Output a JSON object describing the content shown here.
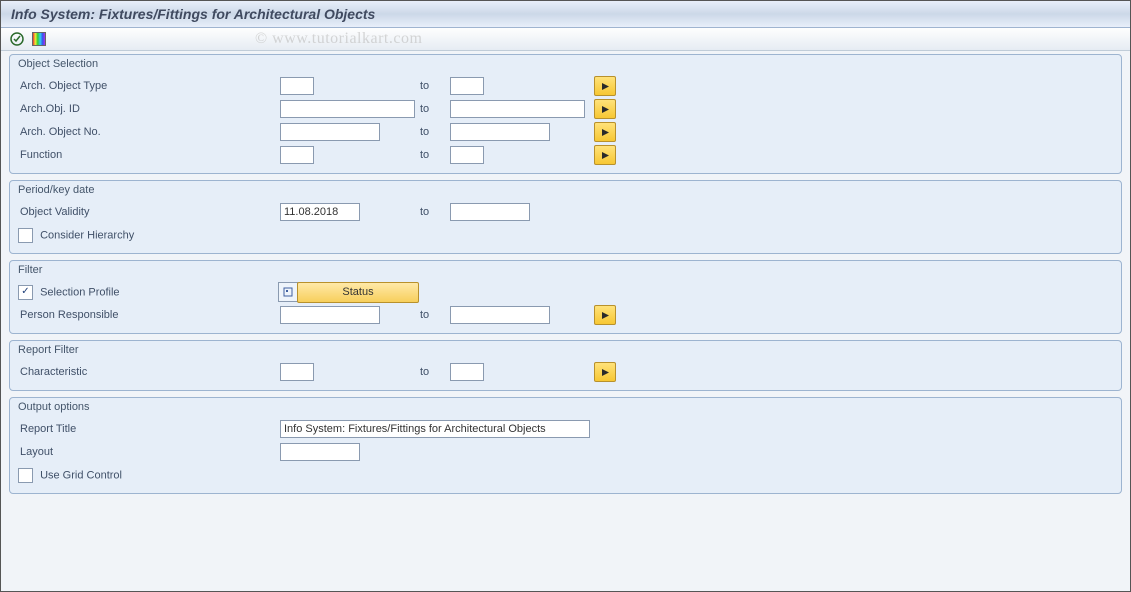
{
  "title": "Info System: Fixtures/Fittings for Architectural Objects",
  "watermark": "© www.tutorialkart.com",
  "to_label": "to",
  "groups": {
    "object_selection": {
      "legend": "Object Selection",
      "arch_object_type": {
        "label": "Arch. Object Type",
        "from": "",
        "to": ""
      },
      "arch_obj_id": {
        "label": "Arch.Obj. ID",
        "from": "",
        "to": ""
      },
      "arch_object_no": {
        "label": "Arch. Object No.",
        "from": "",
        "to": ""
      },
      "function": {
        "label": "Function",
        "from": "",
        "to": ""
      }
    },
    "period_key_date": {
      "legend": "Period/key date",
      "object_validity": {
        "label": "Object Validity",
        "from": "11.08.2018",
        "to": ""
      },
      "consider_hierarchy": {
        "label": "Consider Hierarchy",
        "checked": false
      }
    },
    "filter": {
      "legend": "Filter",
      "selection_profile": {
        "label": "Selection Profile",
        "checked": true,
        "value": ""
      },
      "status_button": "Status",
      "person_responsible": {
        "label": "Person Responsible",
        "from": "",
        "to": ""
      }
    },
    "report_filter": {
      "legend": "Report Filter",
      "characteristic": {
        "label": "Characteristic",
        "from": "",
        "to": ""
      }
    },
    "output_options": {
      "legend": "Output options",
      "report_title": {
        "label": "Report Title",
        "value": "Info System: Fixtures/Fittings for Architectural Objects"
      },
      "layout": {
        "label": "Layout",
        "value": ""
      },
      "use_grid_control": {
        "label": "Use Grid Control",
        "checked": false
      }
    }
  }
}
